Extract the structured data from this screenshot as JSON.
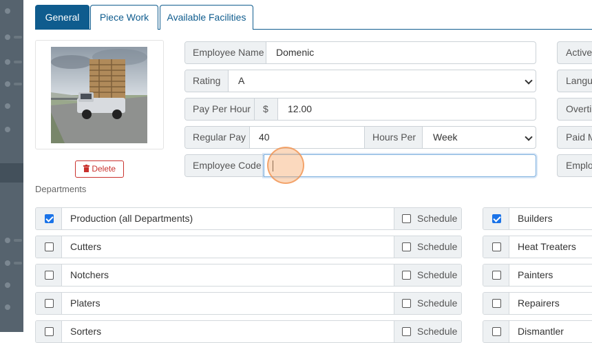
{
  "tabs": [
    "General",
    "Piece Work",
    "Available Facilities"
  ],
  "photo": {
    "delete_label": "Delete"
  },
  "form": {
    "employee_name_label": "Employee Name",
    "employee_name_value": "Domenic",
    "rating_label": "Rating",
    "rating_value": "A",
    "pay_per_hour_label": "Pay Per Hour",
    "currency_symbol": "$",
    "pay_per_hour_value": "12.00",
    "regular_pay_label": "Regular Pay",
    "regular_pay_value": "40",
    "hours_per_label": "Hours Per",
    "hours_per_value": "Week",
    "employee_code_label": "Employee Code",
    "employee_code_value": ""
  },
  "right_fields": [
    "Active",
    "Langua",
    "Overti",
    "Paid M",
    "Employ"
  ],
  "departments": {
    "label": "Departments",
    "schedule_label": "Schedule",
    "left": [
      {
        "name": "Production (all Departments)",
        "checked": true
      },
      {
        "name": "Cutters",
        "checked": false
      },
      {
        "name": "Notchers",
        "checked": false
      },
      {
        "name": "Platers",
        "checked": false
      },
      {
        "name": "Sorters",
        "checked": false
      }
    ],
    "right": [
      {
        "name": "Builders",
        "checked": true
      },
      {
        "name": "Heat Treaters",
        "checked": false
      },
      {
        "name": "Painters",
        "checked": false
      },
      {
        "name": "Repairers",
        "checked": false
      },
      {
        "name": "Dismantler",
        "checked": false
      }
    ]
  },
  "colors": {
    "primary": "#0f5c8e",
    "danger": "#c9302c",
    "checkbox_checked": "#1a73e8"
  }
}
